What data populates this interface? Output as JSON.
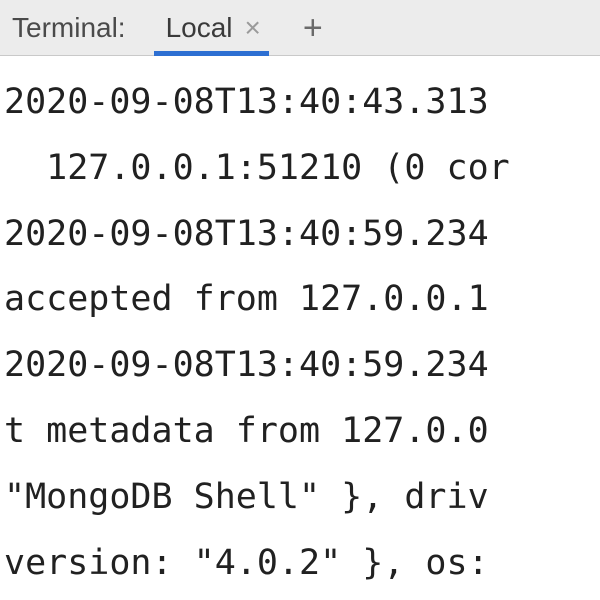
{
  "header": {
    "title": "Terminal:",
    "tab_label": "Local",
    "close_glyph": "×",
    "new_tab_glyph": "+"
  },
  "terminal": {
    "lines": [
      "2020-09-08T13:40:43.313",
      "  127.0.0.1:51210 (0 cor",
      "2020-09-08T13:40:59.234",
      "accepted from 127.0.0.1",
      "2020-09-08T13:40:59.234",
      "t metadata from 127.0.0",
      "\"MongoDB Shell\" }, driv",
      "version: \"4.0.2\" }, os:"
    ]
  }
}
